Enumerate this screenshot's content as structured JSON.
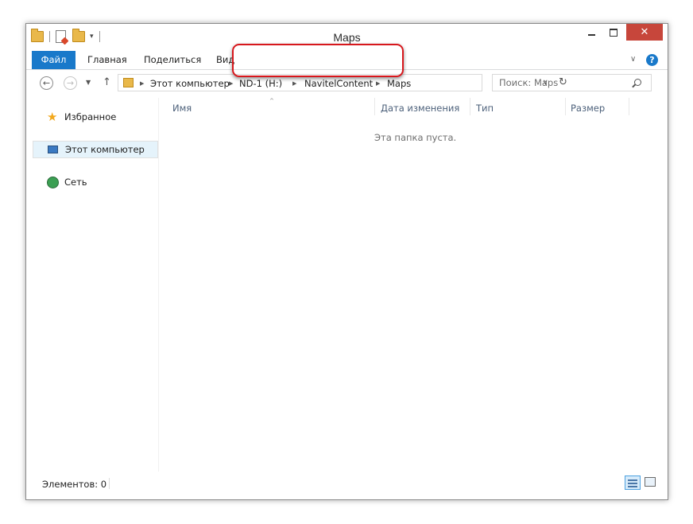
{
  "window": {
    "title": "Maps",
    "controls": {
      "minimize": "minimize",
      "maximize": "maximize",
      "close": "✕"
    }
  },
  "ribbon": {
    "tabs": [
      "Файл",
      "Главная",
      "Поделиться",
      "Вид"
    ],
    "accent": "#1979ca",
    "help": "?"
  },
  "address": {
    "breadcrumbs": [
      "Этот компьютер",
      "ND-1 (H:)",
      "NavitelContent",
      "Maps"
    ]
  },
  "search": {
    "placeholder": "Поиск: Maps"
  },
  "sidebar": {
    "items": [
      {
        "label": "Избранное",
        "icon": "star-icon"
      },
      {
        "label": "Этот компьютер",
        "icon": "computer-icon"
      },
      {
        "label": "Сеть",
        "icon": "network-icon"
      }
    ]
  },
  "content": {
    "columns": [
      "Имя",
      "Дата изменения",
      "Тип",
      "Размер"
    ],
    "empty_message": "Эта папка пуста."
  },
  "status": {
    "items_count": "Элементов: 0"
  },
  "colors": {
    "highlight": "#d7171c",
    "close_button": "#c7463b",
    "selection": "#e5f3fb"
  }
}
